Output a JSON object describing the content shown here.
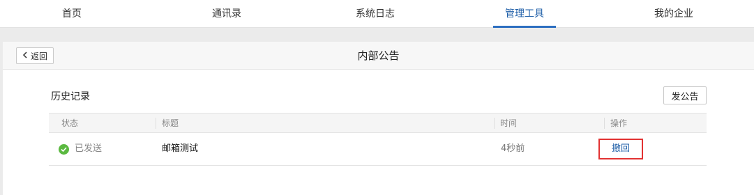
{
  "nav": {
    "tabs": [
      {
        "label": "首页"
      },
      {
        "label": "通讯录"
      },
      {
        "label": "系统日志"
      },
      {
        "label": "管理工具"
      },
      {
        "label": "我的企业"
      }
    ],
    "active_index": 3
  },
  "header": {
    "back_label": "返回",
    "title": "内部公告"
  },
  "section": {
    "title": "历史记录",
    "publish_label": "发公告"
  },
  "table": {
    "columns": [
      "状态",
      "标题",
      "时间",
      "操作"
    ],
    "rows": [
      {
        "status": "已发送",
        "subject": "邮箱测试",
        "time": "4秒前",
        "action": "撤回"
      }
    ]
  },
  "colors": {
    "accent": "#2d6fc0",
    "link": "#1f5fa8",
    "success": "#5bb940",
    "highlight_border": "#e23232"
  },
  "icons": {
    "back": "chevron-left-icon",
    "status": "check-circle-icon"
  }
}
